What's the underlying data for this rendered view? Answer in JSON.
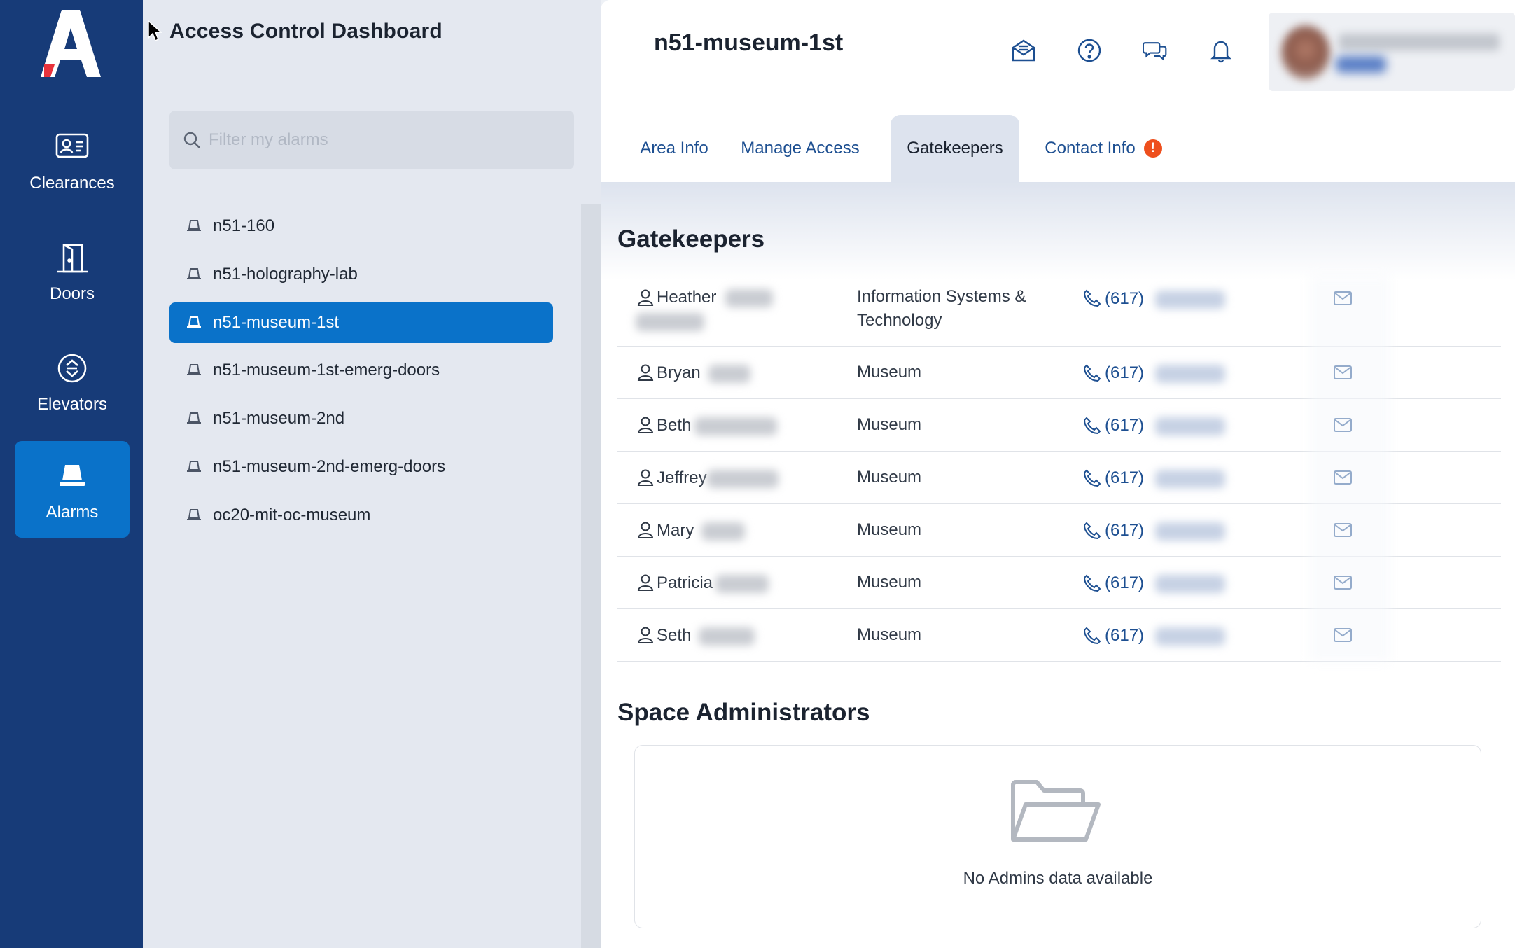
{
  "app": {
    "title": "Access Control Dashboard"
  },
  "nav": {
    "items": [
      {
        "label": "Clearances",
        "icon": "id-card-icon",
        "active": false
      },
      {
        "label": "Doors",
        "icon": "door-icon",
        "active": false
      },
      {
        "label": "Elevators",
        "icon": "elevator-icon",
        "active": false
      },
      {
        "label": "Alarms",
        "icon": "alarm-light-icon",
        "active": true
      }
    ]
  },
  "search": {
    "placeholder": "Filter my alarms",
    "value": ""
  },
  "alarms": [
    {
      "label": "n51-160",
      "selected": false
    },
    {
      "label": "n51-holography-lab",
      "selected": false
    },
    {
      "label": "n51-museum-1st",
      "selected": true
    },
    {
      "label": "n51-museum-1st-emerg-doors",
      "selected": false
    },
    {
      "label": "n51-museum-2nd",
      "selected": false
    },
    {
      "label": "n51-museum-2nd-emerg-doors",
      "selected": false
    },
    {
      "label": "oc20-mit-oc-museum",
      "selected": false
    }
  ],
  "header": {
    "area_title": "n51-museum-1st",
    "icons": [
      "mail-tray-icon",
      "help-icon",
      "chat-icon",
      "bell-icon"
    ]
  },
  "tabs": [
    {
      "label": "Area Info",
      "active": false
    },
    {
      "label": "Manage Access",
      "active": false
    },
    {
      "label": "Gatekeepers",
      "active": true
    },
    {
      "label": "Contact Info",
      "active": false,
      "badge": "!"
    }
  ],
  "gatekeepers": {
    "title": "Gatekeepers",
    "rows": [
      {
        "first_name": "Heather",
        "department": "Information Systems & Technology",
        "phone_prefix": "(617)"
      },
      {
        "first_name": "Bryan",
        "department": "Museum",
        "phone_prefix": "(617)"
      },
      {
        "first_name": "Beth",
        "department": "Museum",
        "phone_prefix": "(617)"
      },
      {
        "first_name": "Jeffrey",
        "department": "Museum",
        "phone_prefix": "(617)"
      },
      {
        "first_name": "Mary",
        "department": "Museum",
        "phone_prefix": "(617)"
      },
      {
        "first_name": "Patricia",
        "department": "Museum",
        "phone_prefix": "(617)"
      },
      {
        "first_name": "Seth",
        "department": "Museum",
        "phone_prefix": "(617)"
      }
    ]
  },
  "space_admins": {
    "title": "Space Administrators",
    "empty_text": "No Admins data available"
  },
  "colors": {
    "rail": "#173b78",
    "active_blue": "#0a72c9",
    "link_blue": "#1d4f91",
    "warn": "#ee4f1d",
    "arrow": "#ef5a4c"
  }
}
